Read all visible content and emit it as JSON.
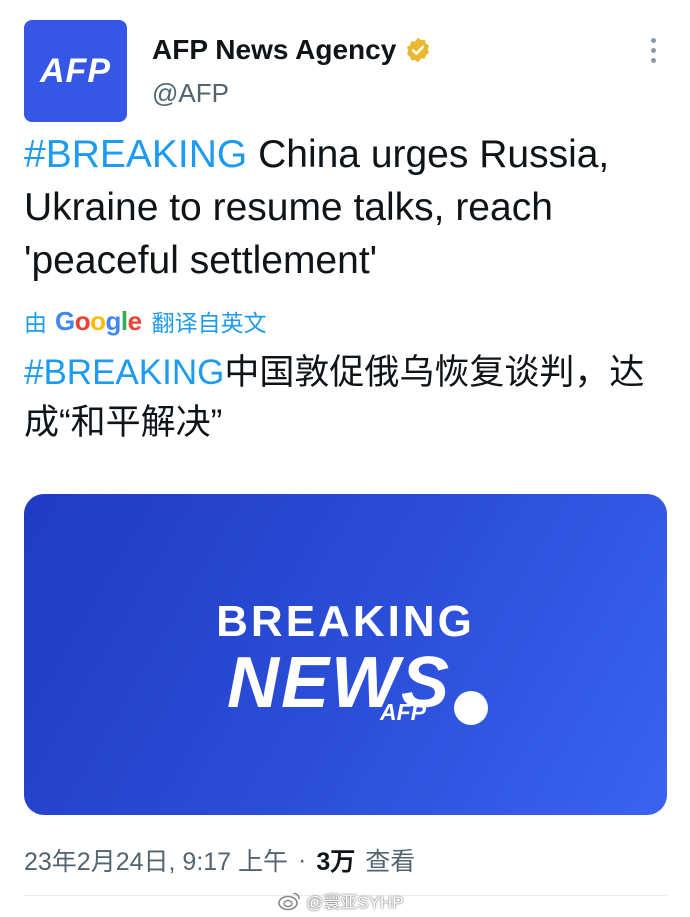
{
  "account": {
    "avatar_text": "AFP",
    "display_name": "AFP News Agency",
    "handle": "@AFP",
    "verified_badge_color": "#e8b82f"
  },
  "tweet": {
    "hashtag": "#BREAKING",
    "text": " China urges Russia, Ukraine to resume talks, reach 'peaceful settlement'"
  },
  "translation": {
    "prefix": "由",
    "google_letters": [
      "G",
      "o",
      "o",
      "g",
      "l",
      "e"
    ],
    "suffix": "翻译自英文",
    "hashtag": "#BREAKING",
    "text": "中国敦促俄乌恢复谈判，达成“和平解决”"
  },
  "media": {
    "line1": "BREAKING",
    "line2": "NEWS",
    "brand": "AFP",
    "background_color": "#2b4fd9"
  },
  "meta": {
    "timestamp": "23年2月24日, 9:17 上午",
    "separator": "·",
    "views_count": "3万",
    "views_label": "查看"
  },
  "watermark": {
    "text": "@寰亚SYHP"
  },
  "colors": {
    "accent": "#1d9bf0",
    "text_primary": "#0f1419",
    "text_secondary": "#536471"
  }
}
